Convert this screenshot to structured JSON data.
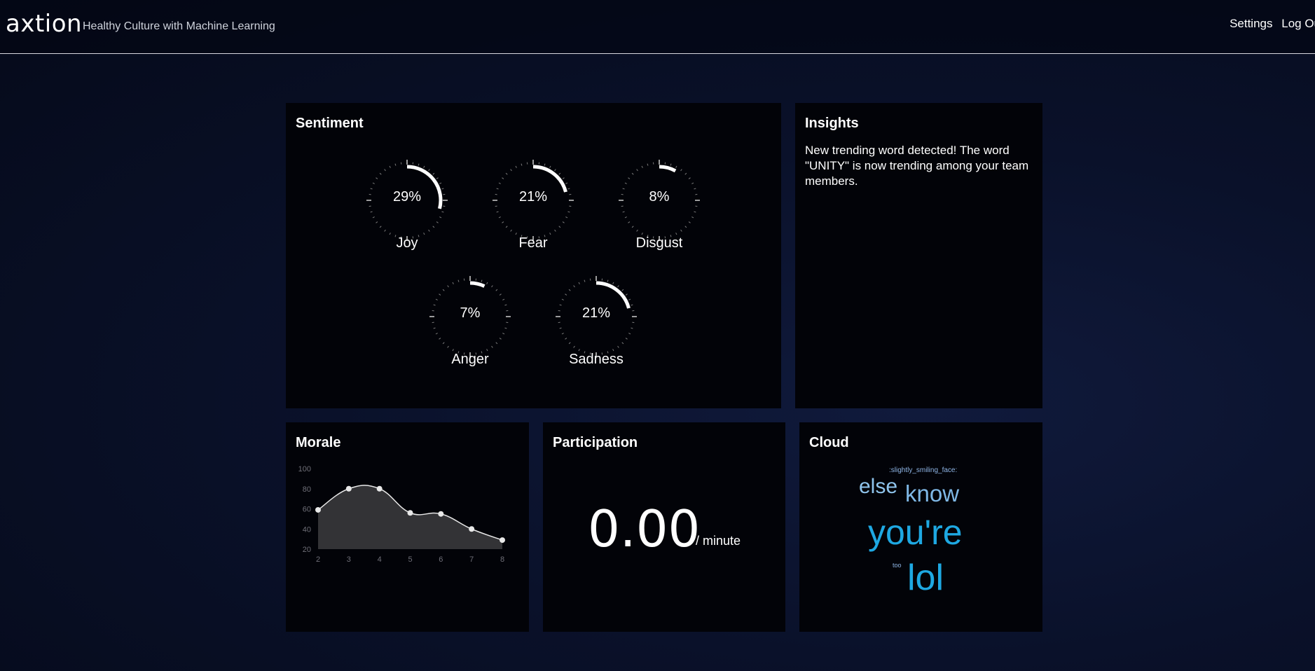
{
  "header": {
    "logo": "axtion",
    "tagline": "Healthy Culture with Machine Learning",
    "nav": {
      "settings": "Settings",
      "logout": "Log Ou"
    }
  },
  "sentiment": {
    "title": "Sentiment",
    "gauges": [
      {
        "label": "Joy",
        "value": 29,
        "display": "29%"
      },
      {
        "label": "Fear",
        "value": 21,
        "display": "21%"
      },
      {
        "label": "Disgust",
        "value": 8,
        "display": "8%"
      },
      {
        "label": "Anger",
        "value": 7,
        "display": "7%"
      },
      {
        "label": "Sadness",
        "value": 21,
        "display": "21%"
      }
    ]
  },
  "insights": {
    "title": "Insights",
    "text": "New trending word detected! The word \"UNITY\" is now trending among your team members."
  },
  "morale": {
    "title": "Morale"
  },
  "participation": {
    "title": "Participation",
    "value": "0.00",
    "unit": "/ minute"
  },
  "cloud": {
    "title": "Cloud",
    "words": [
      {
        "text": ":slightly_smiling_face:",
        "color": "#8fb6e6"
      },
      {
        "text": "else",
        "color": "#8fc4ec"
      },
      {
        "text": "know",
        "color": "#7fb8e6"
      },
      {
        "text": "you're",
        "color": "#1ea8e2"
      },
      {
        "text": "too",
        "color": "#8fb6e6"
      },
      {
        "text": "lol",
        "color": "#1ea8e2"
      }
    ]
  },
  "chart_data": {
    "type": "area",
    "x": [
      2,
      3,
      4,
      5,
      6,
      7,
      8
    ],
    "y": [
      59,
      80,
      80,
      56,
      55,
      40,
      29
    ],
    "xticks": [
      "2",
      "3",
      "4",
      "5",
      "6",
      "7",
      "8"
    ],
    "yticks": [
      "100",
      "80",
      "60",
      "40",
      "20"
    ],
    "ylim": [
      20,
      100
    ],
    "xlim": [
      2,
      8
    ],
    "fill_color": "#333336",
    "line_color": "#e8e8e8"
  }
}
